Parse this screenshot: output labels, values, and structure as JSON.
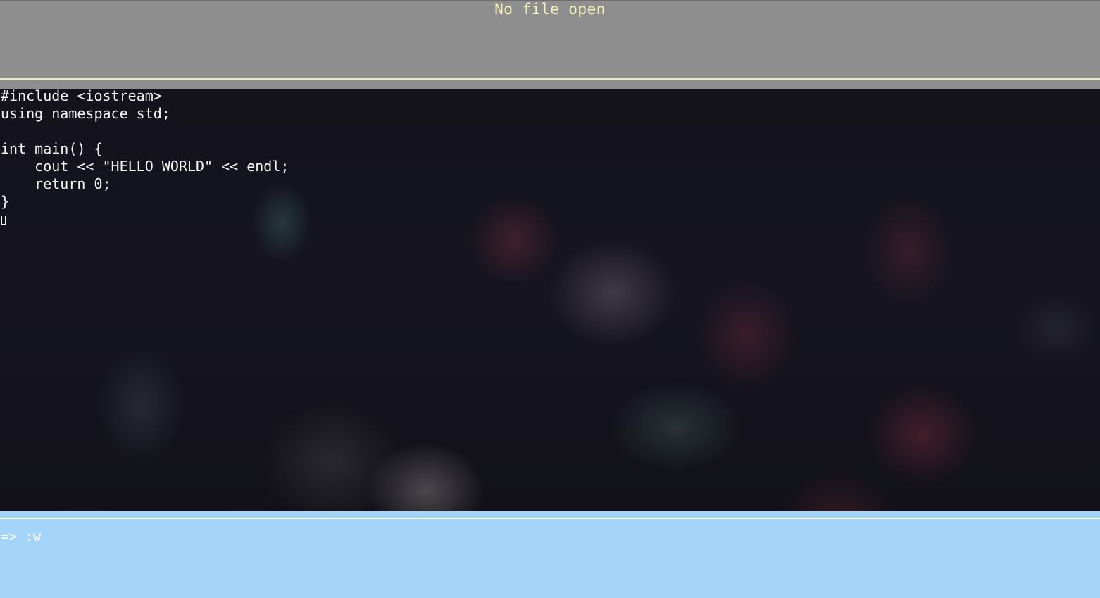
{
  "titlebar": {
    "status_text": "No file open"
  },
  "editor": {
    "lines": [
      "#include <iostream>",
      "using namespace std;",
      "",
      "int main() {",
      "    cout << \"HELLO WORLD\" << endl;",
      "    return 0;",
      "}"
    ]
  },
  "command": {
    "prompt": "=>",
    "input": ":w"
  },
  "colors": {
    "titlebar_bg": "#8e8e8e",
    "titlebar_text": "#f4f3b8",
    "command_bg": "#a5d4fb",
    "code_text": "#f4f4f4"
  }
}
